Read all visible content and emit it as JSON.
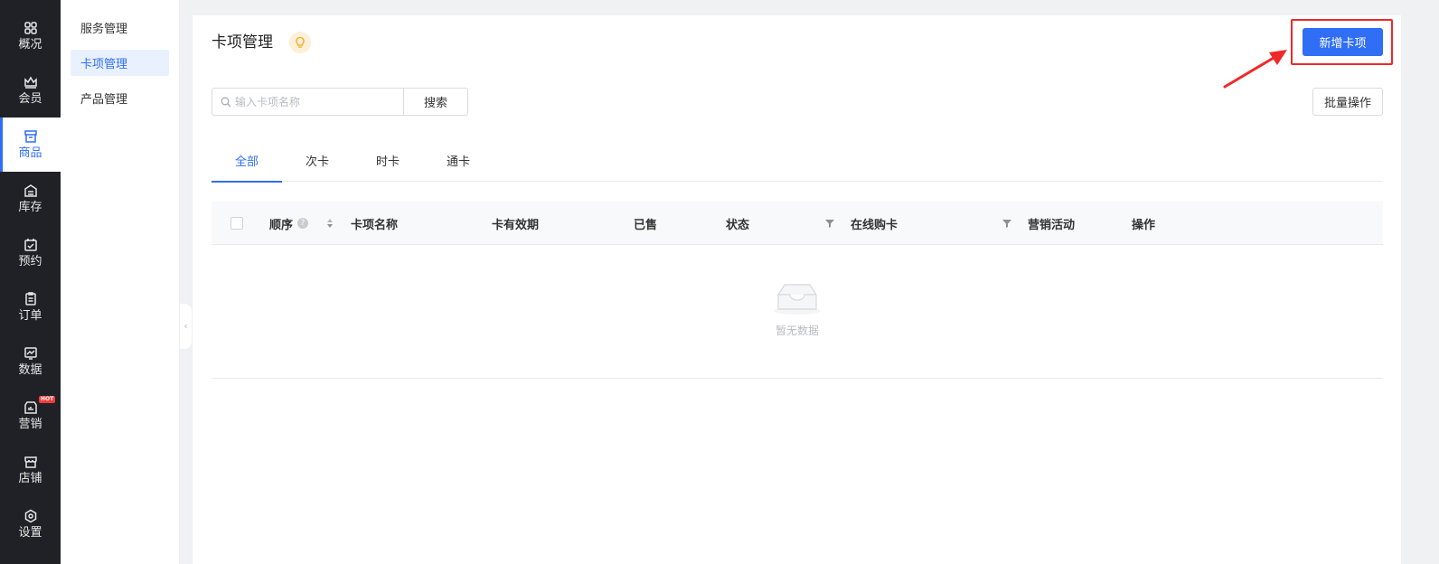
{
  "nav": {
    "items": [
      {
        "label": "概况",
        "icon": "dashboard-icon"
      },
      {
        "label": "会员",
        "icon": "crown-icon"
      },
      {
        "label": "商品",
        "icon": "store-icon"
      },
      {
        "label": "库存",
        "icon": "inventory-icon"
      },
      {
        "label": "预约",
        "icon": "calendar-check-icon"
      },
      {
        "label": "订单",
        "icon": "clipboard-icon"
      },
      {
        "label": "数据",
        "icon": "chart-icon"
      },
      {
        "label": "营销",
        "icon": "marketing-icon",
        "badge": "HOT"
      },
      {
        "label": "店铺",
        "icon": "shop-icon"
      },
      {
        "label": "设置",
        "icon": "settings-icon"
      }
    ],
    "active": "商品"
  },
  "subnav": {
    "items": [
      {
        "label": "服务管理"
      },
      {
        "label": "卡项管理"
      },
      {
        "label": "产品管理"
      }
    ],
    "active": "卡项管理"
  },
  "header": {
    "title": "卡项管理",
    "add_label": "新增卡项"
  },
  "search": {
    "placeholder": "输入卡项名称",
    "value": "",
    "button_label": "搜索"
  },
  "batch_label": "批量操作",
  "tabs": [
    {
      "label": "全部"
    },
    {
      "label": "次卡"
    },
    {
      "label": "时卡"
    },
    {
      "label": "通卡"
    }
  ],
  "table": {
    "columns": {
      "order": "顺序",
      "name": "卡项名称",
      "validity": "卡有效期",
      "sold": "已售",
      "status": "状态",
      "online": "在线购卡",
      "marketing": "营销活动",
      "actions": "操作"
    },
    "rows": [],
    "empty_text": "暂无数据"
  },
  "colors": {
    "primary": "#2f6ef5",
    "nav_bg": "#1f2126",
    "highlight": "#f02828",
    "hot_badge": "#f23b3b"
  }
}
